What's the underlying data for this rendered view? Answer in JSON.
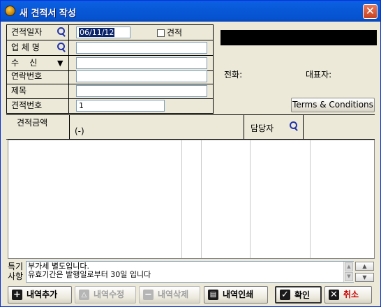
{
  "window": {
    "title": "새 견적서 작성",
    "close_glyph": "✕"
  },
  "form": {
    "rows": [
      {
        "label": "견적일자",
        "value": "06/11/12"
      },
      {
        "label": "업 체 명",
        "value": ""
      },
      {
        "label": "수    신",
        "value": ""
      },
      {
        "label": "연락번호",
        "value": ""
      },
      {
        "label": "제목",
        "value": ""
      },
      {
        "label": "견적번호",
        "value": "1"
      }
    ],
    "estimate_checkbox_label": "견적",
    "estimate_checked": false,
    "recipient_dropdown_glyph": "▼"
  },
  "info": {
    "phone_label": "전화:",
    "rep_label": "대표자:",
    "terms_button": "Terms & Conditions"
  },
  "amount": {
    "label": "견적금액",
    "value": "(-)",
    "manager_label": "담당자"
  },
  "notes": {
    "label_line1": "특기",
    "label_line2": "사항",
    "lines": [
      "부가세 별도입니다.",
      "유효기간은 발행일로부터 30일 입니다"
    ]
  },
  "buttons": {
    "add_item": "내역추가",
    "edit_item": "내역수정",
    "delete_item": "내역삭제",
    "print_item": "내역인쇄",
    "ok": "확인",
    "cancel": "취소"
  },
  "icons": {
    "app": "app-coin-icon",
    "search": "magnifier-icon",
    "add": "plus-icon",
    "edit": "triangle-icon",
    "delete": "minus-icon",
    "print": "printer-icon",
    "ok": "check-icon",
    "cancel": "x-icon"
  },
  "colors": {
    "title_bar": "#0a5fe0",
    "ok_icon": "#1a1a1a",
    "cancel_text": "#cc0000"
  }
}
